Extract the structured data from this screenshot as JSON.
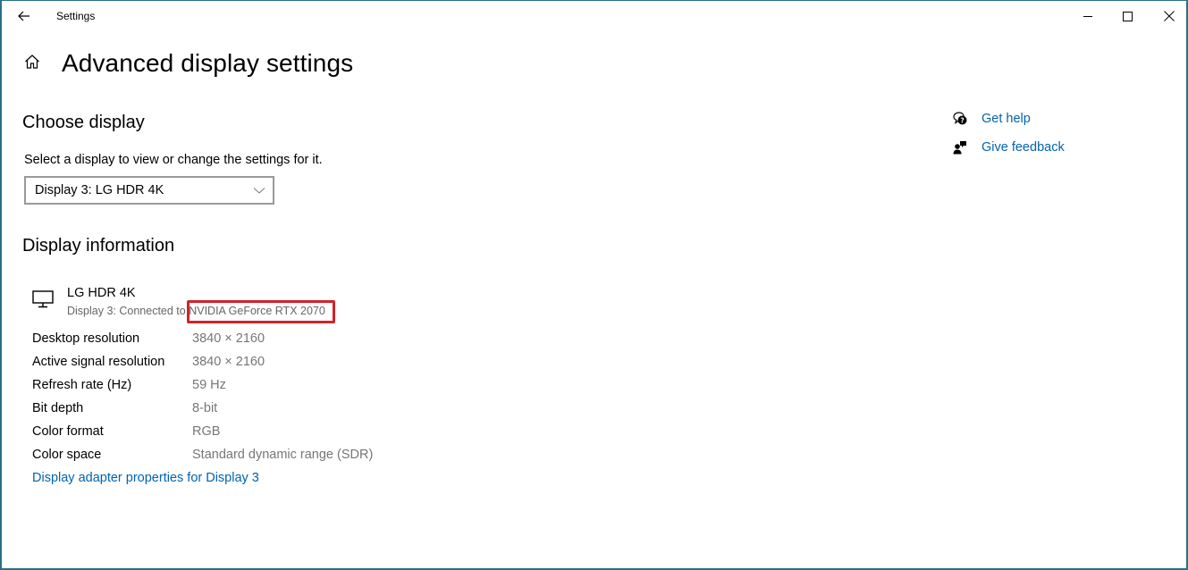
{
  "window": {
    "app_title": "Settings",
    "controls": {
      "minimize": "minimize",
      "maximize": "maximize",
      "close": "close"
    },
    "border_color": "#2b6f8a"
  },
  "page": {
    "title": "Advanced display settings"
  },
  "choose_display": {
    "heading": "Choose display",
    "description": "Select a display to view or change the settings for it.",
    "selected_display": "Display 3: LG HDR 4K"
  },
  "display_information": {
    "heading": "Display information",
    "monitor_name": "LG HDR 4K",
    "connection_prefix": "Display 3: Connected to ",
    "adapter_name": "NVIDIA GeForce RTX 2070",
    "highlight_color": "#d2232a",
    "rows": [
      {
        "label": "Desktop resolution",
        "value": "3840 × 2160"
      },
      {
        "label": "Active signal resolution",
        "value": "3840 × 2160"
      },
      {
        "label": "Refresh rate (Hz)",
        "value": "59 Hz"
      },
      {
        "label": "Bit depth",
        "value": "8-bit"
      },
      {
        "label": "Color format",
        "value": "RGB"
      },
      {
        "label": "Color space",
        "value": "Standard dynamic range (SDR)"
      }
    ],
    "adapter_link": "Display adapter properties for Display 3"
  },
  "help": {
    "items": [
      {
        "label": "Get help",
        "icon": "help-chat-icon"
      },
      {
        "label": "Give feedback",
        "icon": "feedback-icon"
      }
    ]
  },
  "colors": {
    "link": "#0063b1",
    "secondary_text": "#767676"
  }
}
